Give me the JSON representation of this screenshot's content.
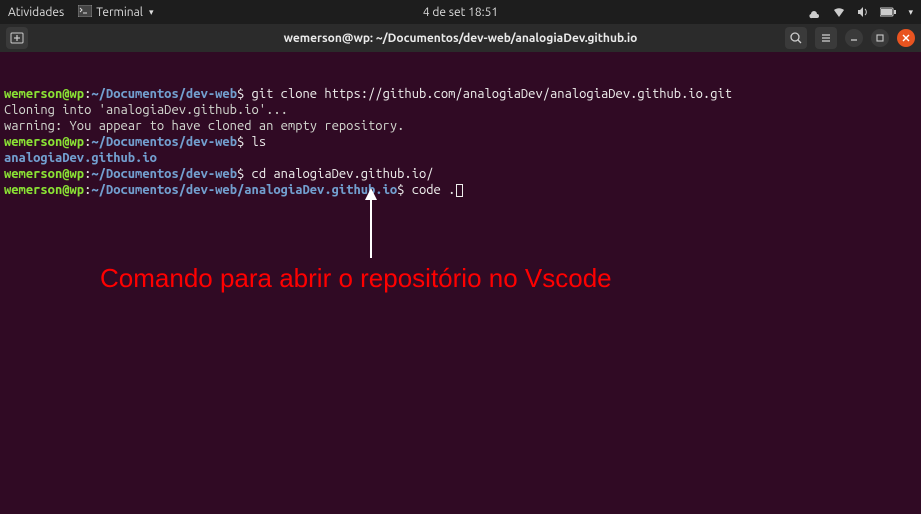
{
  "topbar": {
    "activities": "Atividades",
    "app_label": "Terminal",
    "datetime": "4 de set  18:51"
  },
  "titlebar": {
    "title": "wemerson@wp: ~/Documentos/dev-web/analogiaDev.github.io"
  },
  "terminal": {
    "lines": [
      {
        "user": "wemerson@wp",
        "path": "~/Documentos/dev-web",
        "cmd": "git clone https://github.com/analogiaDev/analogiaDev.github.io.git"
      },
      {
        "out": "Cloning into 'analogiaDev.github.io'..."
      },
      {
        "out": "warning: You appear to have cloned an empty repository."
      },
      {
        "user": "wemerson@wp",
        "path": "~/Documentos/dev-web",
        "cmd": "ls"
      },
      {
        "out_blue": "analogiaDev.github.io"
      },
      {
        "user": "wemerson@wp",
        "path": "~/Documentos/dev-web",
        "cmd": "cd analogiaDev.github.io/"
      },
      {
        "user": "wemerson@wp",
        "path": "~/Documentos/dev-web/analogiaDev.github.io",
        "cmd": "code .",
        "cursor": true
      }
    ]
  },
  "annotation": {
    "text": "Comando para abrir o repositório no Vscode"
  }
}
